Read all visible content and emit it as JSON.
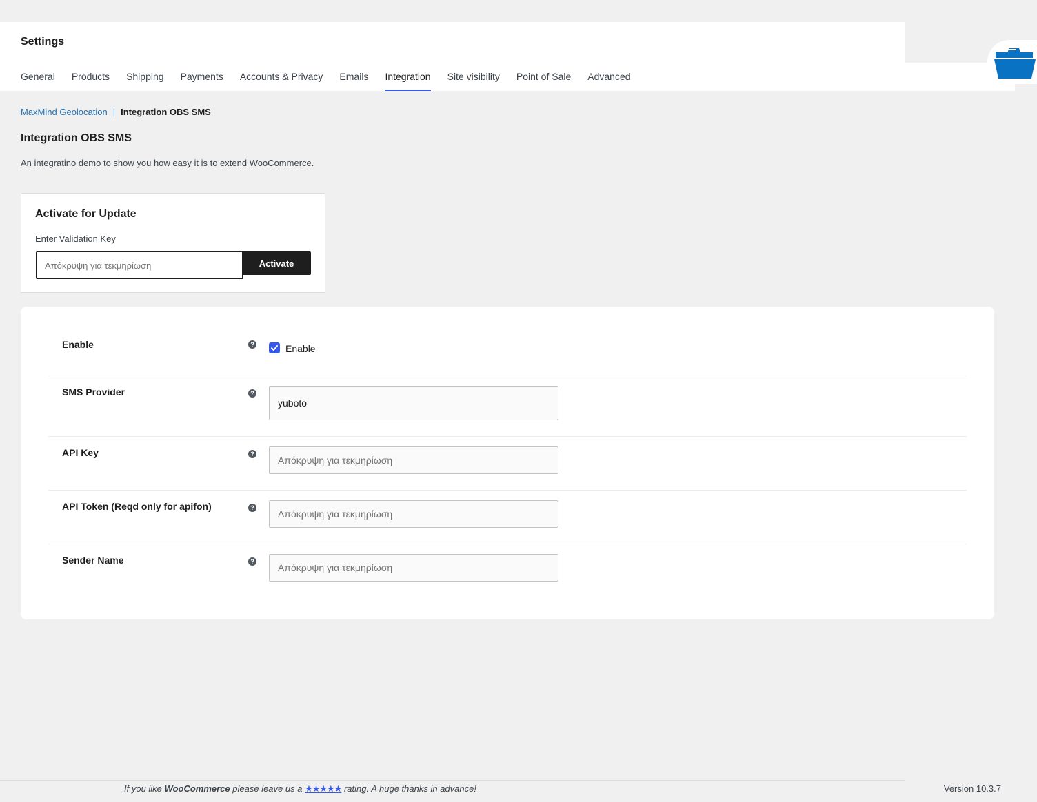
{
  "header": {
    "title": "Settings",
    "tabs": [
      {
        "label": "General"
      },
      {
        "label": "Products"
      },
      {
        "label": "Shipping"
      },
      {
        "label": "Payments"
      },
      {
        "label": "Accounts & Privacy"
      },
      {
        "label": "Emails"
      },
      {
        "label": "Integration",
        "active": true
      },
      {
        "label": "Site visibility"
      },
      {
        "label": "Point of Sale"
      },
      {
        "label": "Advanced"
      }
    ]
  },
  "breadcrumb": {
    "link": "MaxMind Geolocation",
    "separator": "|",
    "current": "Integration OBS SMS"
  },
  "section": {
    "title": "Integration OBS SMS",
    "description": "An integratino demo to show you how easy it is to extend WooCommerce."
  },
  "activate": {
    "title": "Activate for Update",
    "label": "Enter Validation Key",
    "placeholder": "Απόκρυψη για τεκμηρίωση",
    "button_label": "Activate"
  },
  "settings": {
    "help_glyph": "?",
    "enable": {
      "label": "Enable",
      "checkbox_label": "Enable",
      "checked": true
    },
    "sms_provider": {
      "label": "SMS Provider",
      "value": "yuboto"
    },
    "api_key": {
      "label": "API Key",
      "placeholder": "Απόκρυψη για τεκμηρίωση"
    },
    "api_token": {
      "label": "API Token (Reqd only for apifon)",
      "placeholder": "Απόκρυψη για τεκμηρίωση"
    },
    "sender_name": {
      "label": "Sender Name",
      "placeholder": "Απόκρυψη για τεκμηρίωση"
    }
  },
  "footer": {
    "text_before": "If you like ",
    "brand": "WooCommerce",
    "text_middle": " please leave us a ",
    "stars": "★★★★★",
    "text_after": " rating. A huge thanks in advance!",
    "version": "Version 10.3.7"
  },
  "colors": {
    "accent": "#3858e9",
    "link": "#2271b1",
    "dark_button": "#1e1e1e",
    "background": "#f0f0f1",
    "folder_icon": "#0a72c2"
  },
  "icons": {
    "folder": "folder-open-icon",
    "help": "help-icon",
    "check": "check-icon"
  }
}
